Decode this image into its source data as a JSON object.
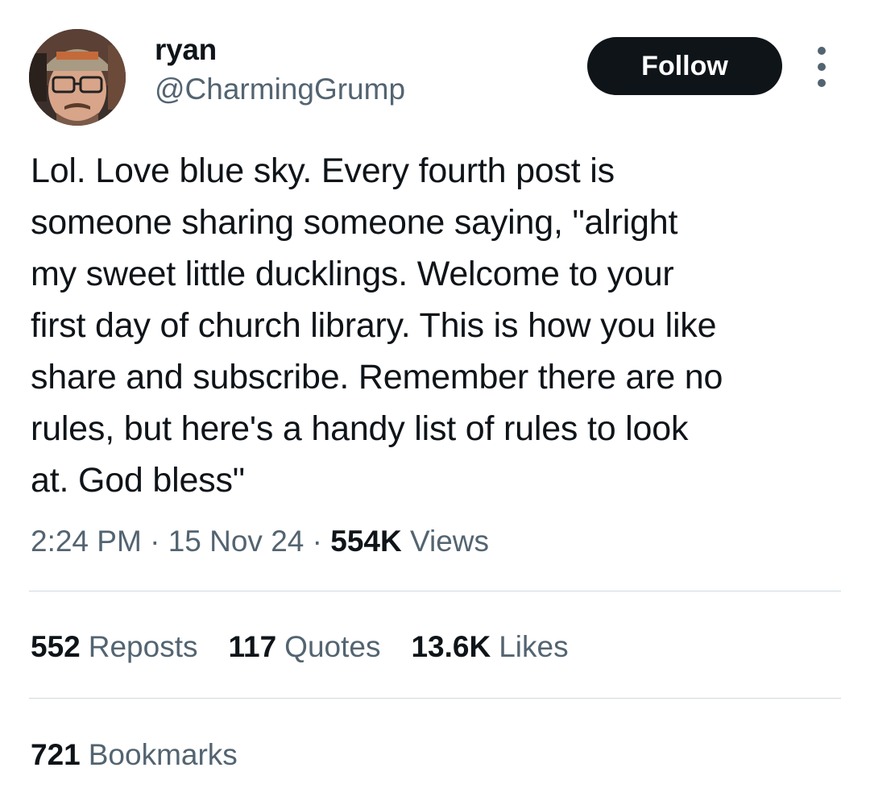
{
  "author": {
    "display_name": "ryan",
    "handle": "@CharmingGrump",
    "avatar_icon": "profile-photo-avatar"
  },
  "actions": {
    "follow_label": "Follow",
    "more_icon": "more-vertical-icon"
  },
  "post": {
    "text": "Lol. Love blue sky. Every fourth post is\nsomeone sharing someone saying, \"alright\nmy sweet little ducklings. Welcome to your\nfirst day of church library. This is how you like\nshare and subscribe. Remember there are no\nrules, but here's a handy list of rules to look\nat. God bless\""
  },
  "meta": {
    "time": "2:24 PM",
    "separator": "·",
    "date": "15 Nov 24",
    "views_count": "554K",
    "views_label": "Views"
  },
  "stats": {
    "reposts_count": "552",
    "reposts_label": "Reposts",
    "quotes_count": "117",
    "quotes_label": "Quotes",
    "likes_count": "13.6K",
    "likes_label": "Likes",
    "bookmarks_count": "721",
    "bookmarks_label": "Bookmarks"
  },
  "colors": {
    "text_primary": "#0f1419",
    "text_secondary": "#536471",
    "divider": "#cfd9de",
    "button_bg": "#0f1419",
    "button_text": "#ffffff"
  }
}
